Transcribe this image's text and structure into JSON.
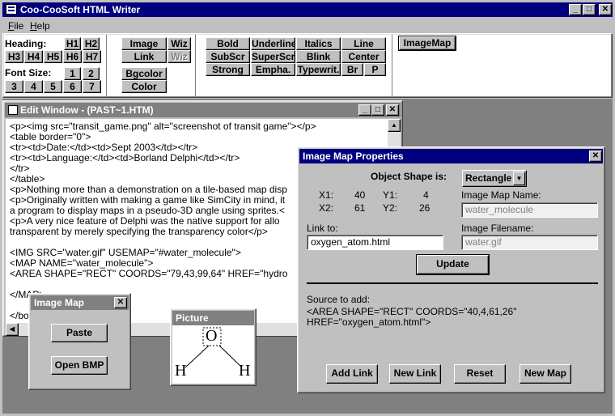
{
  "app": {
    "title": "Coo-CooSoft HTML Writer",
    "menu": [
      "File",
      "Help"
    ]
  },
  "toolbar": {
    "heading_label": "Heading:",
    "headings": [
      "H1",
      "H2",
      "H3",
      "H4",
      "H5",
      "H6",
      "H7"
    ],
    "fontsize_label": "Font Size:",
    "fontsizes": [
      "1",
      "2",
      "3",
      "4",
      "5",
      "6",
      "7"
    ],
    "image": "Image",
    "wiz1": "Wiz",
    "link": "Link",
    "wiz2": "Wiz",
    "bgcolor": "Bgcolor",
    "color": "Color",
    "format": [
      "Bold",
      "Underline",
      "Italics",
      "Line",
      "SubScr",
      "SuperScr",
      "Blink",
      "Center",
      "Strong",
      "Empha.",
      "Typewrit.",
      "Br",
      "P"
    ],
    "imagemap": "ImageMap"
  },
  "edit_window": {
    "title": "Edit Window - (PAST~1.HTM)",
    "lines": [
      "<p><img src=\"transit_game.png\" alt=\"screenshot of transit game\"></p>",
      "<table border=\"0\">",
      "<tr><td>Date:</td><td>Sept 2003</td></tr>",
      "<tr><td>Language:</td><td>Borland Delphi</td></tr>",
      "</tr>",
      "</table>",
      "<p>Nothing more than a demonstration on a tile-based map disp",
      "<p>Originally written with making a game like SimCity in mind, it",
      "a program to display maps in a pseudo-3D angle using sprites.<",
      "<p>A very nice feature of Delphi was the native support for allo",
      "transparent by merely specifying the transparency color</p>",
      "",
      "<IMG SRC=\"water.gif\" USEMAP=\"#water_molecule\">",
      "<MAP NAME=\"water_molecule\">",
      "<AREA SHAPE=\"RECT\" COORDS=\"79,43,99,64\" HREF=\"hydro",
      "",
      "</MAP>",
      "",
      "</bo"
    ]
  },
  "image_map_tool": {
    "title": "Image Map",
    "paste": "Paste",
    "open_bmp": "Open BMP"
  },
  "picture": {
    "title": "Picture",
    "atom_o": "O",
    "atom_h1": "H",
    "atom_h2": "H"
  },
  "props": {
    "title": "Image Map Properties",
    "shape_label": "Object Shape is:",
    "shape_value": "Rectangle",
    "x1_label": "X1:",
    "x1": "40",
    "y1_label": "Y1:",
    "y1": "4",
    "x2_label": "X2:",
    "x2": "61",
    "y2_label": "Y2:",
    "y2": "26",
    "map_name_label": "Image Map Name:",
    "map_name": "water_molecule",
    "link_label": "Link to:",
    "link": "oxygen_atom.html",
    "filename_label": "Image Filename:",
    "filename": "water.gif",
    "update": "Update",
    "source_label": "Source to add:",
    "source_line1": "<AREA SHAPE=\"RECT\" COORDS=\"40,4,61,26\"",
    "source_line2": "HREF=\"oxygen_atom.html\">",
    "add_link": "Add Link",
    "new_link": "New Link",
    "reset": "Reset",
    "new_map": "New Map"
  }
}
